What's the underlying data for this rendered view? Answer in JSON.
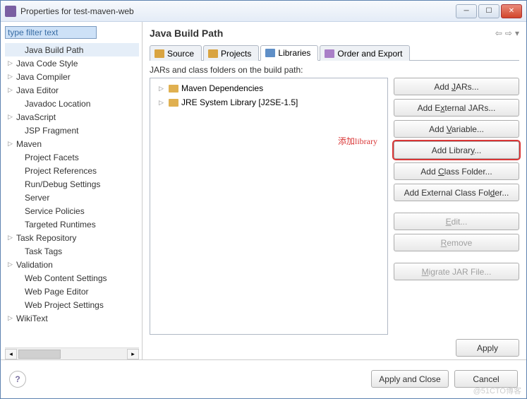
{
  "window": {
    "title": "Properties for test-maven-web"
  },
  "sidebar": {
    "filter_text": "type filter text",
    "items": [
      {
        "label": "Java Build Path",
        "expandable": false,
        "indent": true,
        "selected": true
      },
      {
        "label": "Java Code Style",
        "expandable": true
      },
      {
        "label": "Java Compiler",
        "expandable": true
      },
      {
        "label": "Java Editor",
        "expandable": true
      },
      {
        "label": "Javadoc Location",
        "expandable": false,
        "indent": true
      },
      {
        "label": "JavaScript",
        "expandable": true
      },
      {
        "label": "JSP Fragment",
        "expandable": false,
        "indent": true
      },
      {
        "label": "Maven",
        "expandable": true
      },
      {
        "label": "Project Facets",
        "expandable": false,
        "indent": true
      },
      {
        "label": "Project References",
        "expandable": false,
        "indent": true
      },
      {
        "label": "Run/Debug Settings",
        "expandable": false,
        "indent": true
      },
      {
        "label": "Server",
        "expandable": false,
        "indent": true
      },
      {
        "label": "Service Policies",
        "expandable": false,
        "indent": true
      },
      {
        "label": "Targeted Runtimes",
        "expandable": false,
        "indent": true
      },
      {
        "label": "Task Repository",
        "expandable": true
      },
      {
        "label": "Task Tags",
        "expandable": false,
        "indent": true
      },
      {
        "label": "Validation",
        "expandable": true
      },
      {
        "label": "Web Content Settings",
        "expandable": false,
        "indent": true
      },
      {
        "label": "Web Page Editor",
        "expandable": false,
        "indent": true
      },
      {
        "label": "Web Project Settings",
        "expandable": false,
        "indent": true
      },
      {
        "label": "WikiText",
        "expandable": true
      }
    ]
  },
  "main": {
    "heading": "Java Build Path",
    "tabs": [
      {
        "label": "Source"
      },
      {
        "label": "Projects"
      },
      {
        "label": "Libraries",
        "active": true
      },
      {
        "label": "Order and Export"
      }
    ],
    "build_label": "JARs and class folders on the build path:",
    "lib_items": [
      {
        "label": "JRE System Library [J2SE-1.5]"
      },
      {
        "label": "Maven Dependencies"
      }
    ],
    "annotation": "添加library",
    "buttons": {
      "add_jars": "Add JARs...",
      "add_ext_jars": "Add External JARs...",
      "add_variable": "Add Variable...",
      "add_library": "Add Library...",
      "add_class_folder": "Add Class Folder...",
      "add_ext_class_folder": "Add External Class Folder...",
      "edit": "Edit...",
      "remove": "Remove",
      "migrate": "Migrate JAR File..."
    },
    "apply": "Apply"
  },
  "footer": {
    "apply_close": "Apply and Close",
    "cancel": "Cancel"
  },
  "watermark": "@51CTO博客"
}
